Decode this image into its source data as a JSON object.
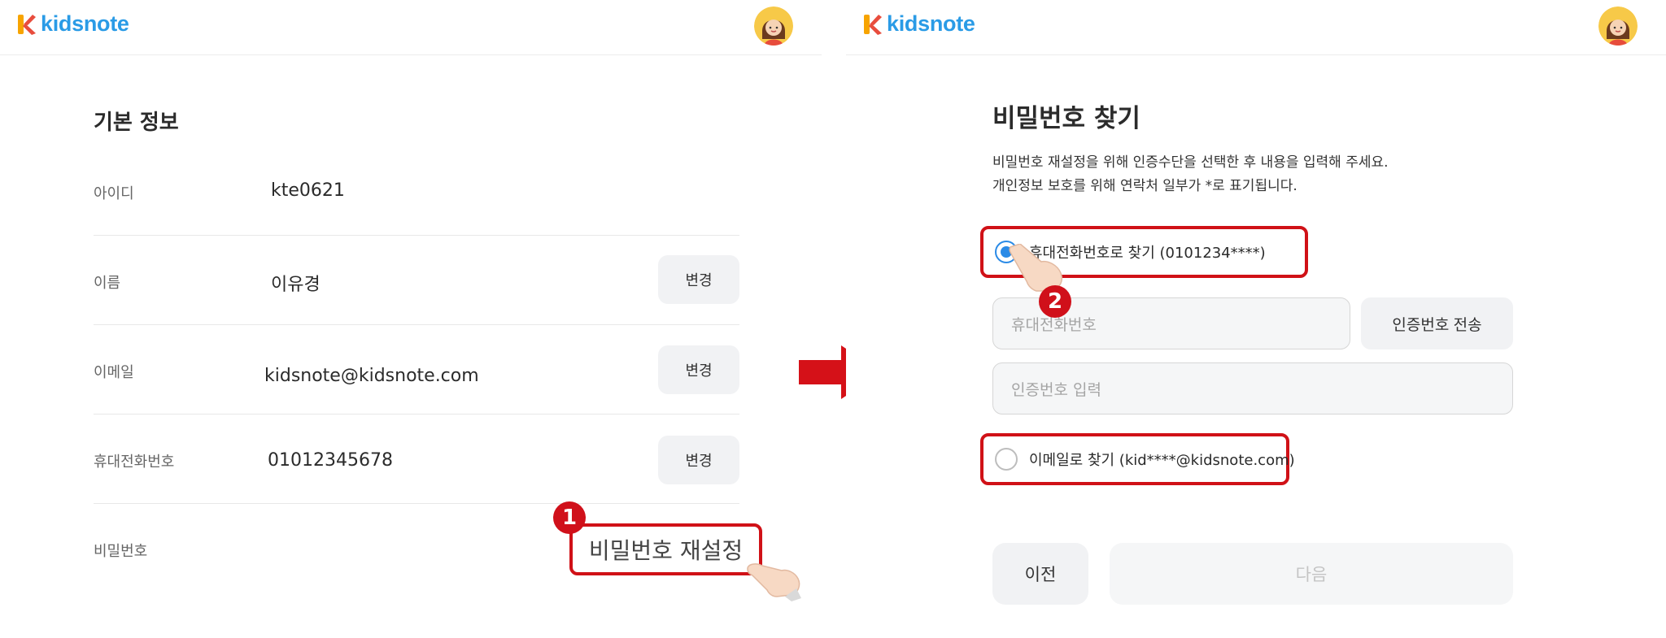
{
  "app": {
    "logo_text": "kidsnote"
  },
  "left": {
    "section_title": "기본 정보",
    "rows": [
      {
        "label": "아이디",
        "value": "kte0621"
      },
      {
        "label": "이름",
        "value": "이유경",
        "button": "변경"
      },
      {
        "label": "이메일",
        "value": "kidsnote@kidsnote.com",
        "button": "변경"
      },
      {
        "label": "휴대전화번호",
        "value": "01012345678",
        "button": "변경"
      },
      {
        "label": "비밀번호"
      }
    ],
    "reset_button": "비밀번호 재설정",
    "step1": "1"
  },
  "right": {
    "title": "비밀번호 찾기",
    "desc_line1": "비밀번호 재설정을 위해 인증수단을 선택한 후 내용을 입력해 주세요.",
    "desc_line2": "개인정보 보호를 위해 연락처 일부가 *로 표기됩니다.",
    "option_phone": "휴대전화번호로 찾기 (0101234****)",
    "phone_placeholder": "휴대전화번호",
    "send_code_button": "인증번호 전송",
    "code_placeholder": "인증번호 입력",
    "option_email": "이메일로 찾기 (kid****@kidsnote.com)",
    "prev_button": "이전",
    "next_button": "다음",
    "step2": "2"
  },
  "colors": {
    "brand_blue": "#2a9be6",
    "annotation_red": "#d01117",
    "radio_blue": "#2a8ae6",
    "button_gray": "#f1f2f4"
  },
  "icons": [
    "kidsnote-logo-icon",
    "avatar-icon",
    "pointing-hand-icon",
    "right-arrow-icon",
    "radio-checked-icon",
    "radio-unchecked-icon"
  ]
}
